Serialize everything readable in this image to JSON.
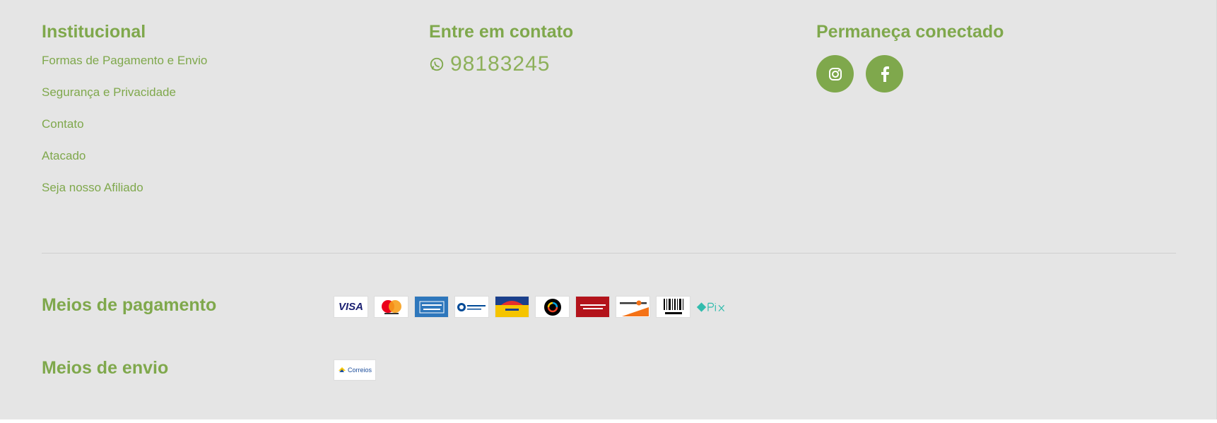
{
  "institutional": {
    "title": "Institucional",
    "links": [
      "Formas de Pagamento e Envio",
      "Segurança e Privacidade",
      "Contato",
      "Atacado",
      "Seja nosso Afiliado"
    ]
  },
  "contact": {
    "title": "Entre em contato",
    "phone": "98183245",
    "icon": "whatsapp-icon"
  },
  "connected": {
    "title": "Permaneça conectado",
    "socials": [
      "instagram-icon",
      "facebook-icon"
    ]
  },
  "payment": {
    "label": "Meios de pagamento",
    "methods": [
      "VISA",
      "Mastercard",
      "American Express",
      "Diners Club",
      "Aura",
      "elo",
      "Hipercard",
      "DISCOVER",
      "Boleto",
      "pix"
    ]
  },
  "shipping": {
    "label": "Meios de envio",
    "methods": [
      "Correios"
    ]
  },
  "colors": {
    "accent": "#7fa84c",
    "background": "#e5e5e5"
  }
}
